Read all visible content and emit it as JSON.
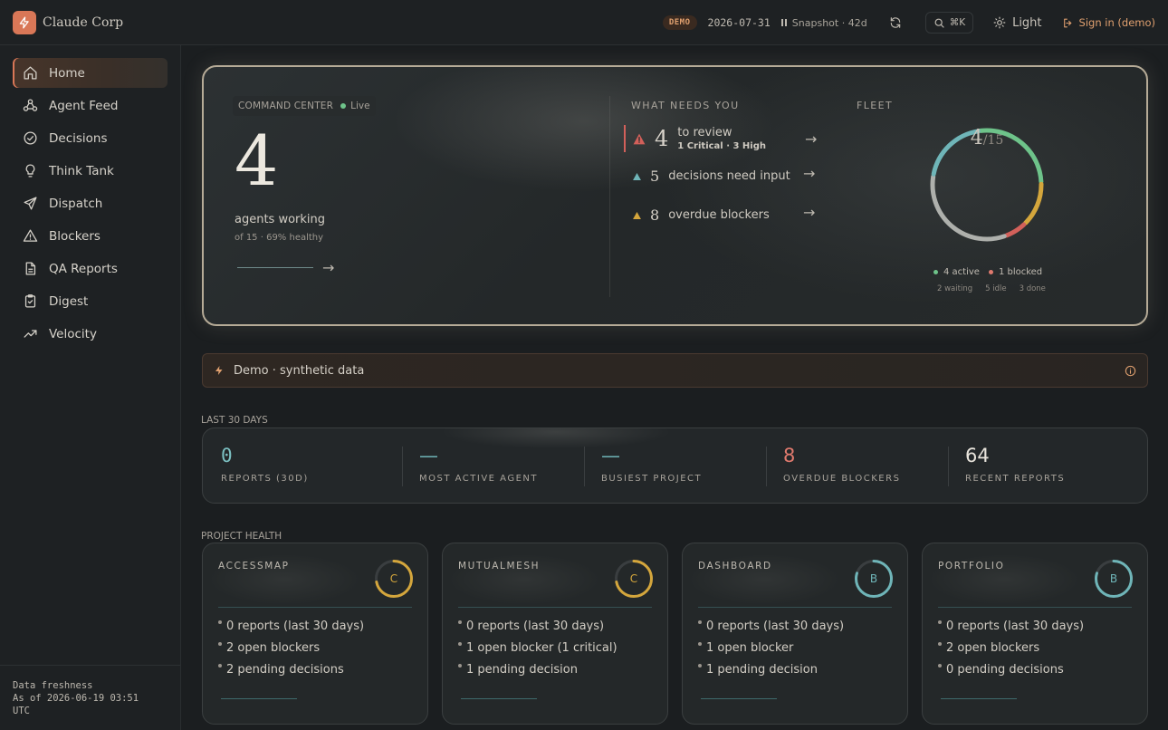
{
  "brand": {
    "name": "Claude Corp"
  },
  "topbar": {
    "demo_badge": "DEMO",
    "date": "2026-07-31",
    "snapshot": "Snapshot · 42d",
    "search_shortcut": "⌘K",
    "theme_label": "Light",
    "signin_label": "Sign in (demo)"
  },
  "sidebar": {
    "items": [
      {
        "label": "Home",
        "icon": "home-icon"
      },
      {
        "label": "Agent Feed",
        "icon": "agents-icon"
      },
      {
        "label": "Decisions",
        "icon": "check-circle-icon"
      },
      {
        "label": "Think Tank",
        "icon": "lightbulb-icon"
      },
      {
        "label": "Dispatch",
        "icon": "send-icon"
      },
      {
        "label": "Blockers",
        "icon": "warning-icon"
      },
      {
        "label": "QA Reports",
        "icon": "document-icon"
      },
      {
        "label": "Digest",
        "icon": "clipboard-icon"
      },
      {
        "label": "Velocity",
        "icon": "trending-up-icon"
      }
    ],
    "freshness": {
      "line1": "Data freshness",
      "line2": "As of 2026-06-19 03:51",
      "line3": "UTC"
    }
  },
  "hero": {
    "command_center_label": "COMMAND CENTER",
    "live_label": "Live",
    "agents_count": "4",
    "agents_label": "agents working",
    "agents_sub": "of 15 · 69% healthy",
    "what_needs_you": {
      "title": "WHAT NEEDS YOU",
      "items": [
        {
          "count": "4",
          "text": "to review",
          "sub": "1 Critical · 3 High",
          "color": "#d2605a"
        },
        {
          "count": "5",
          "text": "decisions need input",
          "color": "#6fb5b8"
        },
        {
          "count": "8",
          "text": "overdue blockers",
          "color": "#d4a63c"
        }
      ]
    },
    "fleet": {
      "title": "FLEET",
      "active": "4",
      "total": "15",
      "legend_active": "4  active",
      "legend_blocked": "1  blocked",
      "legend_waiting": "2 waiting",
      "legend_idle": "5 idle",
      "legend_done": "3 done",
      "segments": [
        {
          "state": "active",
          "count": 4,
          "color": "#6ec38a"
        },
        {
          "state": "waiting",
          "count": 2,
          "color": "#d4a63c"
        },
        {
          "state": "blocked",
          "count": 1,
          "color": "#d2605a"
        },
        {
          "state": "idle",
          "count": 5,
          "color": "#aeb0ac"
        },
        {
          "state": "done",
          "count": 3,
          "color": "#6fb5b8"
        }
      ]
    }
  },
  "demo_banner": {
    "text": "Demo · synthetic data"
  },
  "last30": {
    "label": "LAST 30 DAYS",
    "stats": [
      {
        "value": "0",
        "label": "REPORTS (30D)",
        "color": "#7cc0c2"
      },
      {
        "value": "—",
        "label": "MOST ACTIVE AGENT",
        "color": "#6fb5b8"
      },
      {
        "value": "—",
        "label": "BUSIEST PROJECT",
        "color": "#6fb5b8"
      },
      {
        "value": "8",
        "label": "OVERDUE BLOCKERS",
        "color": "#e07a6e"
      },
      {
        "value": "64",
        "label": "RECENT REPORTS",
        "color": "#e8e4dc"
      }
    ]
  },
  "project_health": {
    "label": "PROJECT HEALTH",
    "projects": [
      {
        "name": "ACCESSMAP",
        "grade": "C",
        "grade_color": "#d4a63c",
        "score": 0.72,
        "items": [
          "0 reports (last 30 days)",
          "2 open blockers",
          "2 pending decisions"
        ]
      },
      {
        "name": "MUTUALMESH",
        "grade": "C",
        "grade_color": "#d4a63c",
        "score": 0.72,
        "items": [
          "0 reports (last 30 days)",
          "1 open blocker (1 critical)",
          "1 pending decision"
        ]
      },
      {
        "name": "DASHBOARD",
        "grade": "B",
        "grade_color": "#6fb5b8",
        "score": 0.8,
        "items": [
          "0 reports (last 30 days)",
          "1 open blocker",
          "1 pending decision"
        ]
      },
      {
        "name": "PORTFOLIO",
        "grade": "B",
        "grade_color": "#6fb5b8",
        "score": 0.8,
        "items": [
          "0 reports (last 30 days)",
          "2 open blockers",
          "0 pending decisions"
        ]
      }
    ]
  }
}
